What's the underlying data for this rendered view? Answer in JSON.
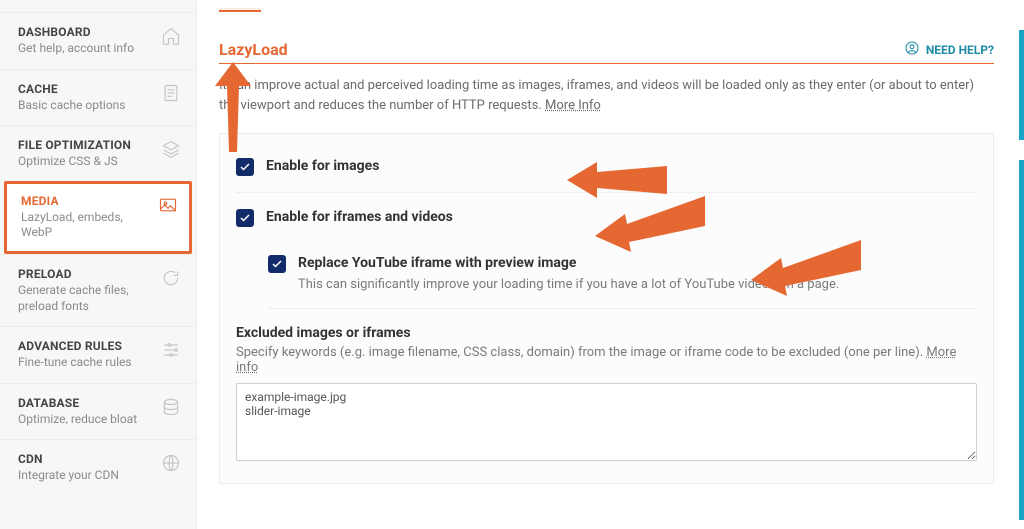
{
  "sidebar": {
    "items": [
      {
        "title": "DASHBOARD",
        "sub": "Get help, account info"
      },
      {
        "title": "CACHE",
        "sub": "Basic cache options"
      },
      {
        "title": "FILE OPTIMIZATION",
        "sub": "Optimize CSS & JS"
      },
      {
        "title": "MEDIA",
        "sub": "LazyLoad, embeds, WebP"
      },
      {
        "title": "PRELOAD",
        "sub": "Generate cache files, preload fonts"
      },
      {
        "title": "ADVANCED RULES",
        "sub": "Fine-tune cache rules"
      },
      {
        "title": "DATABASE",
        "sub": "Optimize, reduce bloat"
      },
      {
        "title": "CDN",
        "sub": "Integrate your CDN"
      }
    ]
  },
  "header": {
    "section_title": "LazyLoad",
    "help_label": "NEED HELP?",
    "description_prefix": "It can improve actual and perceived loading time as images, iframes, and videos will be loaded only as they enter (or about to enter) the viewport and reduces the number of HTTP requests. ",
    "more_info": "More Info"
  },
  "options": {
    "enable_images": "Enable for images",
    "enable_iframes": "Enable for iframes and videos",
    "replace_youtube": "Replace YouTube iframe with preview image",
    "replace_youtube_sub": "This can significantly improve your loading time if you have a lot of YouTube videos on a page."
  },
  "excluded": {
    "title": "Excluded images or iframes",
    "desc_prefix": "Specify keywords (e.g. image filename, CSS class, domain) from the image or iframe code to be excluded (one per line). ",
    "more_info": "More info",
    "value": "example-image.jpg\nslider-image"
  }
}
